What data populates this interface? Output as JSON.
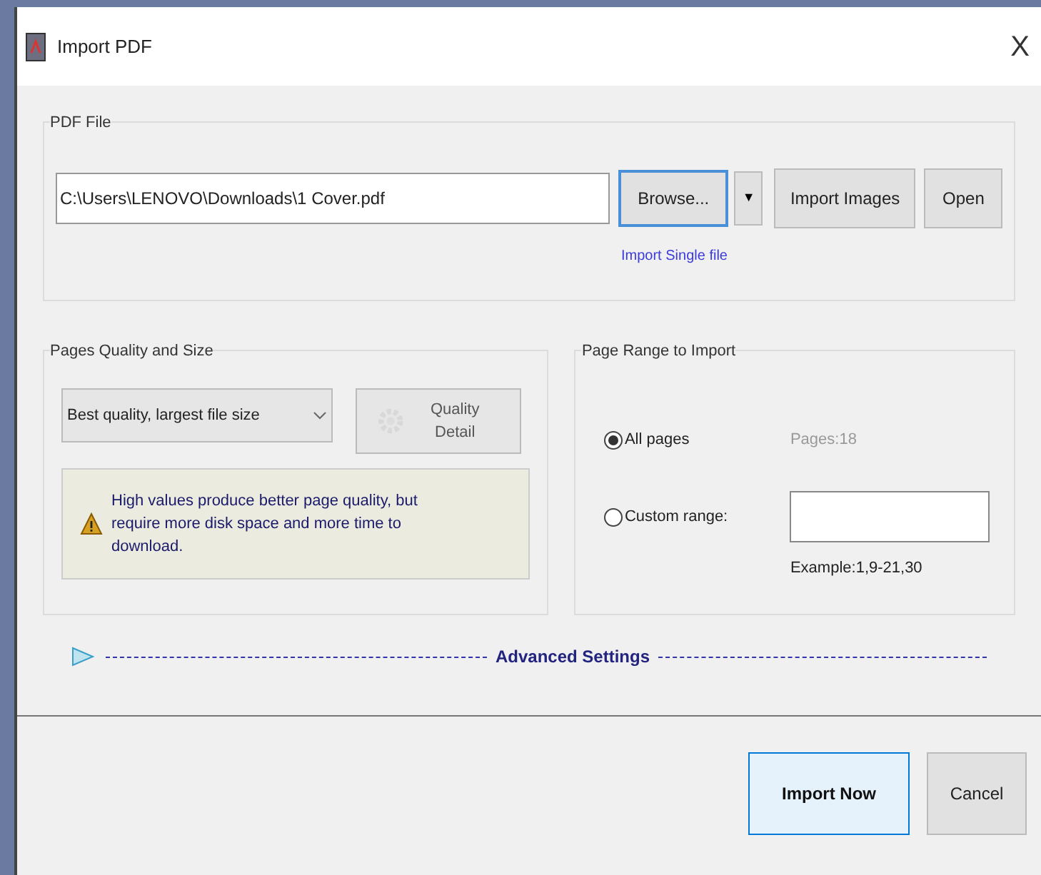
{
  "window": {
    "title": "Import PDF",
    "close": "X"
  },
  "pdf_file": {
    "legend": "PDF File",
    "path": "C:\\Users\\LENOVO\\Downloads\\1 Cover.pdf",
    "browse": "Browse...",
    "dropdown": "▼",
    "import_images": "Import Images",
    "open": "Open",
    "link": "Import Single file"
  },
  "quality": {
    "legend": "Pages Quality and Size",
    "select": "Best quality, largest file size",
    "detail_button": {
      "label": "Quality Detail",
      "disabled": true
    },
    "warning": "High values produce better page quality, but require more disk space and more time to download."
  },
  "page_range": {
    "legend": "Page Range to Import",
    "options": [
      {
        "label": "All pages",
        "selected": true
      },
      {
        "label": "Custom range:",
        "selected": false
      }
    ],
    "pages": "Pages:18",
    "example": "Example:1,9-21,30"
  },
  "advanced": {
    "label": "Advanced Settings",
    "expanded": false
  },
  "buttons": [
    {
      "label": "Import Now",
      "primary": true
    },
    {
      "label": "Cancel",
      "primary": false
    }
  ]
}
